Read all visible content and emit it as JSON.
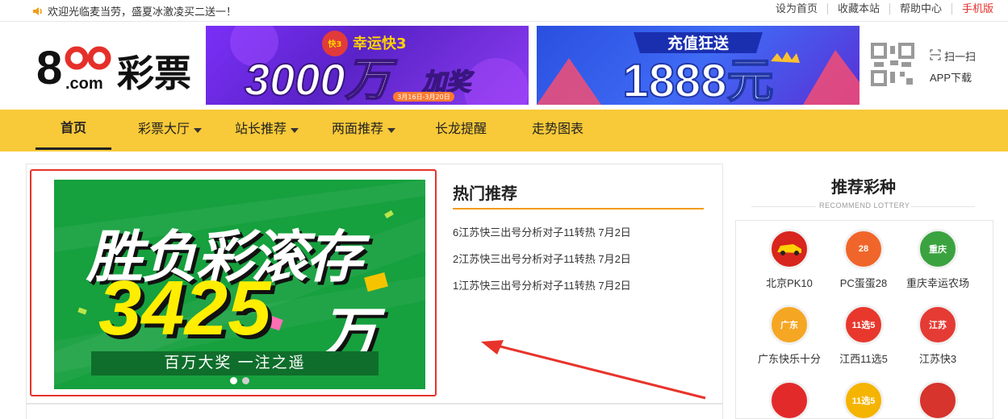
{
  "topbar": {
    "welcome": "欢迎光临麦当劳，盛夏冰激凌买二送一！",
    "links": [
      "设为首页",
      "收藏本站",
      "帮助中心",
      "手机版"
    ]
  },
  "logo": {
    "prefix": "8",
    "mark": "oo",
    "com": ".com",
    "name": "彩票"
  },
  "banners": [
    {
      "tag": "幸运快3",
      "badge": "快3",
      "main": "3000万",
      "accent": "加奖",
      "dates": "3月16日-3月20日"
    },
    {
      "tag": "充值狂送",
      "main": "1888元"
    }
  ],
  "qr": {
    "scan": "扫一扫",
    "app": "APP下载"
  },
  "nav": {
    "items": [
      {
        "label": "首页",
        "active": true,
        "dropdown": false
      },
      {
        "label": "彩票大厅",
        "active": false,
        "dropdown": true
      },
      {
        "label": "站长推荐",
        "active": false,
        "dropdown": true
      },
      {
        "label": "两面推荐",
        "active": false,
        "dropdown": true
      },
      {
        "label": "长龙提醒",
        "active": false,
        "dropdown": false
      },
      {
        "label": "走势图表",
        "active": false,
        "dropdown": false
      }
    ]
  },
  "slide": {
    "line1": "胜负彩滚存",
    "amount": "3425",
    "unit": "万",
    "sub": "百万大奖 一注之遥"
  },
  "hot": {
    "title": "热门推荐",
    "items": [
      "6江苏快三出号分析对子11转热 7月2日",
      "2江苏快三出号分析对子11转热 7月2日",
      "1江苏快三出号分析对子11转热 7月2日"
    ]
  },
  "recommend": {
    "title": "推荐彩种",
    "subtitle": "RECOMMEND LOTTERY",
    "lotteries": [
      {
        "name": "北京PK10",
        "badge": "",
        "color": "#d8251d"
      },
      {
        "name": "PC蛋蛋28",
        "badge": "28",
        "color": "#f0662a"
      },
      {
        "name": "重庆幸运农场",
        "badge": "重庆",
        "color": "#3aa33f"
      },
      {
        "name": "广东快乐十分",
        "badge": "广东",
        "color": "#f5a623"
      },
      {
        "name": "江西11选5",
        "badge": "11选5",
        "color": "#e8382d"
      },
      {
        "name": "江苏快3",
        "badge": "江苏",
        "color": "#e53b35"
      },
      {
        "name": "",
        "badge": "",
        "color": "#e32a2a"
      },
      {
        "name": "",
        "badge": "11选5",
        "color": "#f5b400"
      },
      {
        "name": "",
        "badge": "",
        "color": "#d6342c"
      }
    ]
  },
  "colors": {
    "nav_bg": "#f8c938",
    "accent_red": "#e5302a",
    "hot_line": "#f39c12",
    "slide_bg": "#16a03e"
  }
}
